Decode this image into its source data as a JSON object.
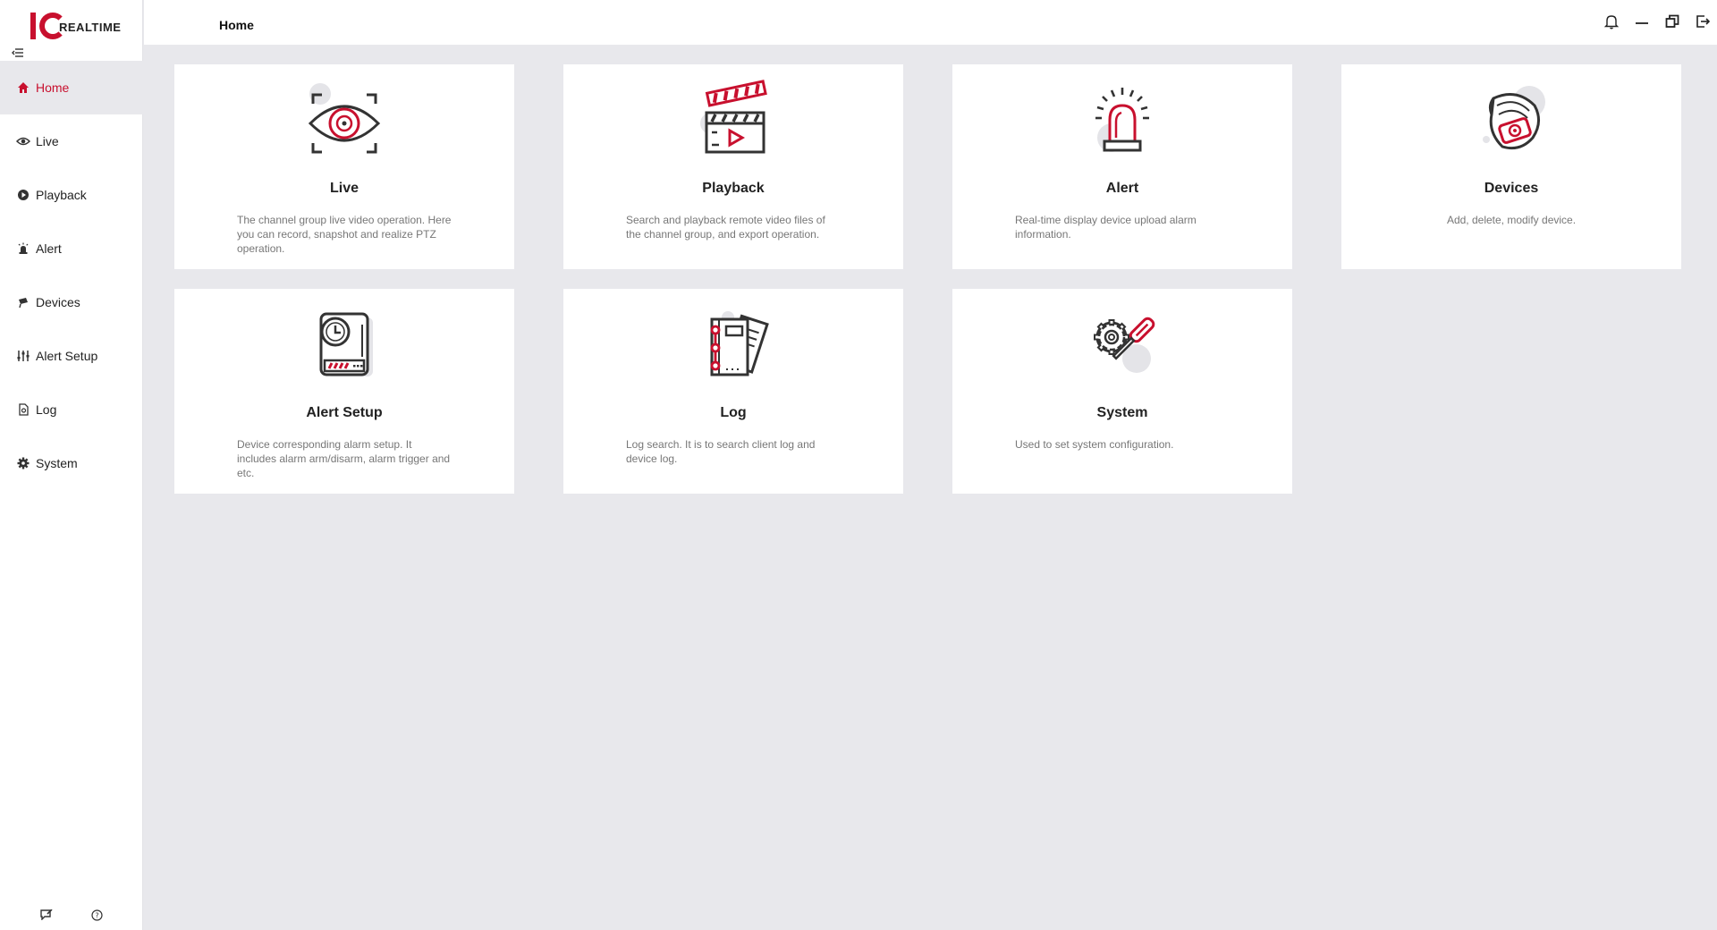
{
  "app": {
    "brand": "REALTIME",
    "page_title": "Home"
  },
  "colors": {
    "accent": "#c8102e",
    "background": "#e8e8ec",
    "card": "#ffffff"
  },
  "sidebar": {
    "items": [
      {
        "label": "Home",
        "icon": "home-icon",
        "active": true
      },
      {
        "label": "Live",
        "icon": "live-eye-icon"
      },
      {
        "label": "Playback",
        "icon": "play-circle-icon"
      },
      {
        "label": "Alert",
        "icon": "siren-icon"
      },
      {
        "label": "Devices",
        "icon": "camera-icon"
      },
      {
        "label": "Alert Setup",
        "icon": "sliders-icon"
      },
      {
        "label": "Log",
        "icon": "log-doc-icon"
      },
      {
        "label": "System",
        "icon": "gear-icon"
      }
    ],
    "bottom": [
      "feedback-icon",
      "help-icon"
    ]
  },
  "header": {
    "actions": [
      "bell-icon",
      "minimize-icon",
      "restore-icon",
      "logout-icon"
    ]
  },
  "cards": [
    {
      "title": "Live",
      "desc": "The channel group live video operation. Here you can record, snapshot and realize PTZ operation.",
      "icon": "eye-scan-icon"
    },
    {
      "title": "Playback",
      "desc": "Search and playback remote video files of the channel group, and export operation.",
      "icon": "clapperboard-icon"
    },
    {
      "title": "Alert",
      "desc": "Real-time display device upload alarm information.",
      "icon": "alarm-siren-icon"
    },
    {
      "title": "Devices",
      "desc": "Add, delete, modify device.",
      "icon": "dome-camera-icon"
    },
    {
      "title": "Alert Setup",
      "desc": "Device corresponding alarm setup. It includes alarm arm/disarm, alarm trigger and etc.",
      "icon": "alarm-clock-device-icon"
    },
    {
      "title": "Log",
      "desc": "Log search. It is to search client log and device log.",
      "icon": "notebook-icon"
    },
    {
      "title": "System",
      "desc": "Used to set system configuration.",
      "icon": "gear-wrench-icon"
    }
  ]
}
